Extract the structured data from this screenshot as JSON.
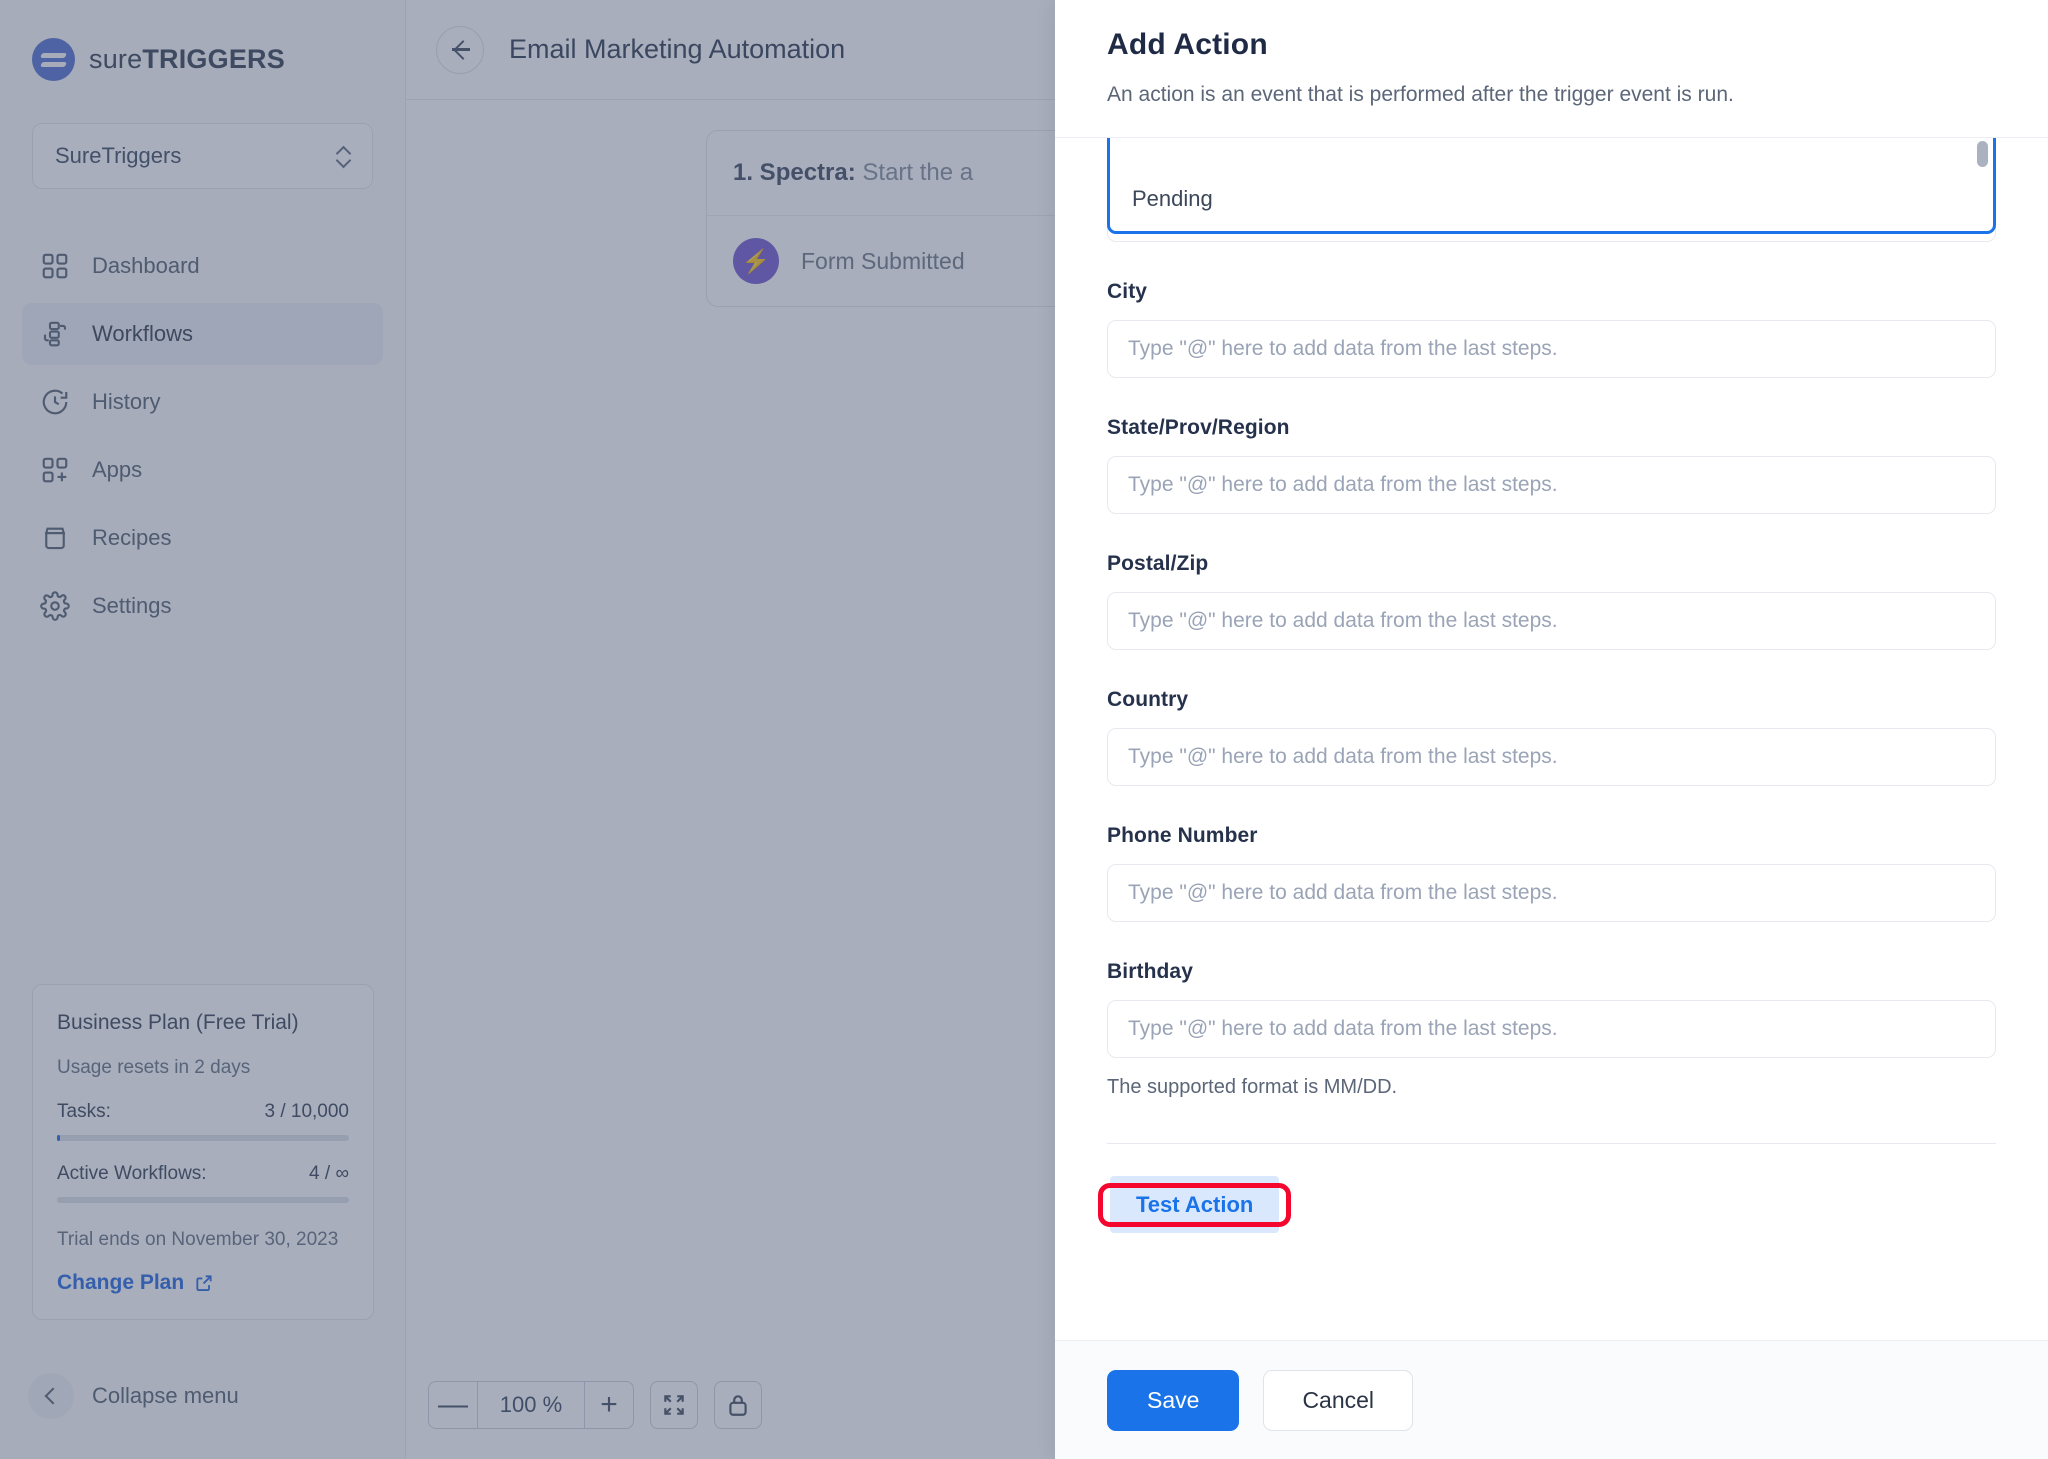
{
  "brand": {
    "prefix": "sure",
    "bold": "TRIGGERS"
  },
  "sidebar": {
    "workspace": "SureTriggers",
    "items": [
      {
        "label": "Dashboard",
        "icon": "grid-icon"
      },
      {
        "label": "Workflows",
        "icon": "workflow-icon"
      },
      {
        "label": "History",
        "icon": "clock-history-icon"
      },
      {
        "label": "Apps",
        "icon": "apps-add-icon"
      },
      {
        "label": "Recipes",
        "icon": "box-icon"
      },
      {
        "label": "Settings",
        "icon": "gear-icon"
      }
    ],
    "plan": {
      "title": "Business Plan (Free Trial)",
      "usage_reset": "Usage resets in 2 days",
      "tasks_label": "Tasks:",
      "tasks_value": "3 / 10,000",
      "tasks_percent": 1,
      "workflows_label": "Active Workflows:",
      "workflows_value": "4 / ∞",
      "workflows_percent": 0,
      "trial_end": "Trial ends on November 30, 2023",
      "change_plan": "Change Plan"
    },
    "collapse": "Collapse menu"
  },
  "canvas": {
    "title": "Email Marketing Automation",
    "back_icon": "arrow-left-icon",
    "close_icon": "close-icon",
    "workflow_card": {
      "step_prefix": "1. Spectra:",
      "step_text": " Start the a",
      "trigger_icon": "spectra-bolt-icon",
      "trigger_label": "Form Submitted"
    },
    "zoom": {
      "minus": "—",
      "value": "100 %",
      "plus": "+",
      "fit_icon": "fit-screen-icon",
      "lock_icon": "lock-icon"
    }
  },
  "panel": {
    "title": "Add Action",
    "subtitle": "An action is an event that is performed after the trigger event is run.",
    "placeholder": "Type \"@\" here to add data from the last steps.",
    "dropdown": {
      "option": "Pending"
    },
    "fields": [
      {
        "label": "City"
      },
      {
        "label": "State/Prov/Region"
      },
      {
        "label": "Postal/Zip"
      },
      {
        "label": "Country"
      },
      {
        "label": "Phone Number"
      },
      {
        "label": "Birthday",
        "help": "The supported format is MM/DD."
      }
    ],
    "test_action": "Test Action",
    "save": "Save",
    "cancel": "Cancel"
  },
  "colors": {
    "accent_blue": "#1a73e8",
    "highlight_red": "#f5062f",
    "brand_purple": "#7a62d4",
    "brand_blue": "#5b77d6"
  }
}
